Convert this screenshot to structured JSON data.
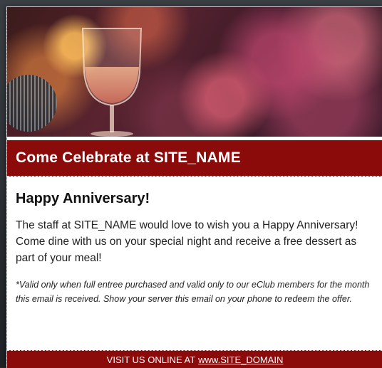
{
  "banner": {
    "title": "Come Celebrate at SITE_NAME"
  },
  "message": {
    "heading": "Happy Anniversary!",
    "body": "The staff at SITE_NAME would love to wish you a Happy Anniversary! Come dine with us on your special night and receive a free dessert as part of your meal!",
    "fine_print": "*Valid only when full entree purchased and valid only to our eClub members for the month this email is received.  Show your server this email on your phone to redeem the offer."
  },
  "footer": {
    "prefix": "VISIT US ONLINE AT",
    "link_text": "www.SITE_DOMAIN"
  },
  "colors": {
    "banner": "#8b0a0a",
    "text": "#222222"
  },
  "hero_image": {
    "subject": "wine glass with rosé at a candlelit table with flowers"
  }
}
